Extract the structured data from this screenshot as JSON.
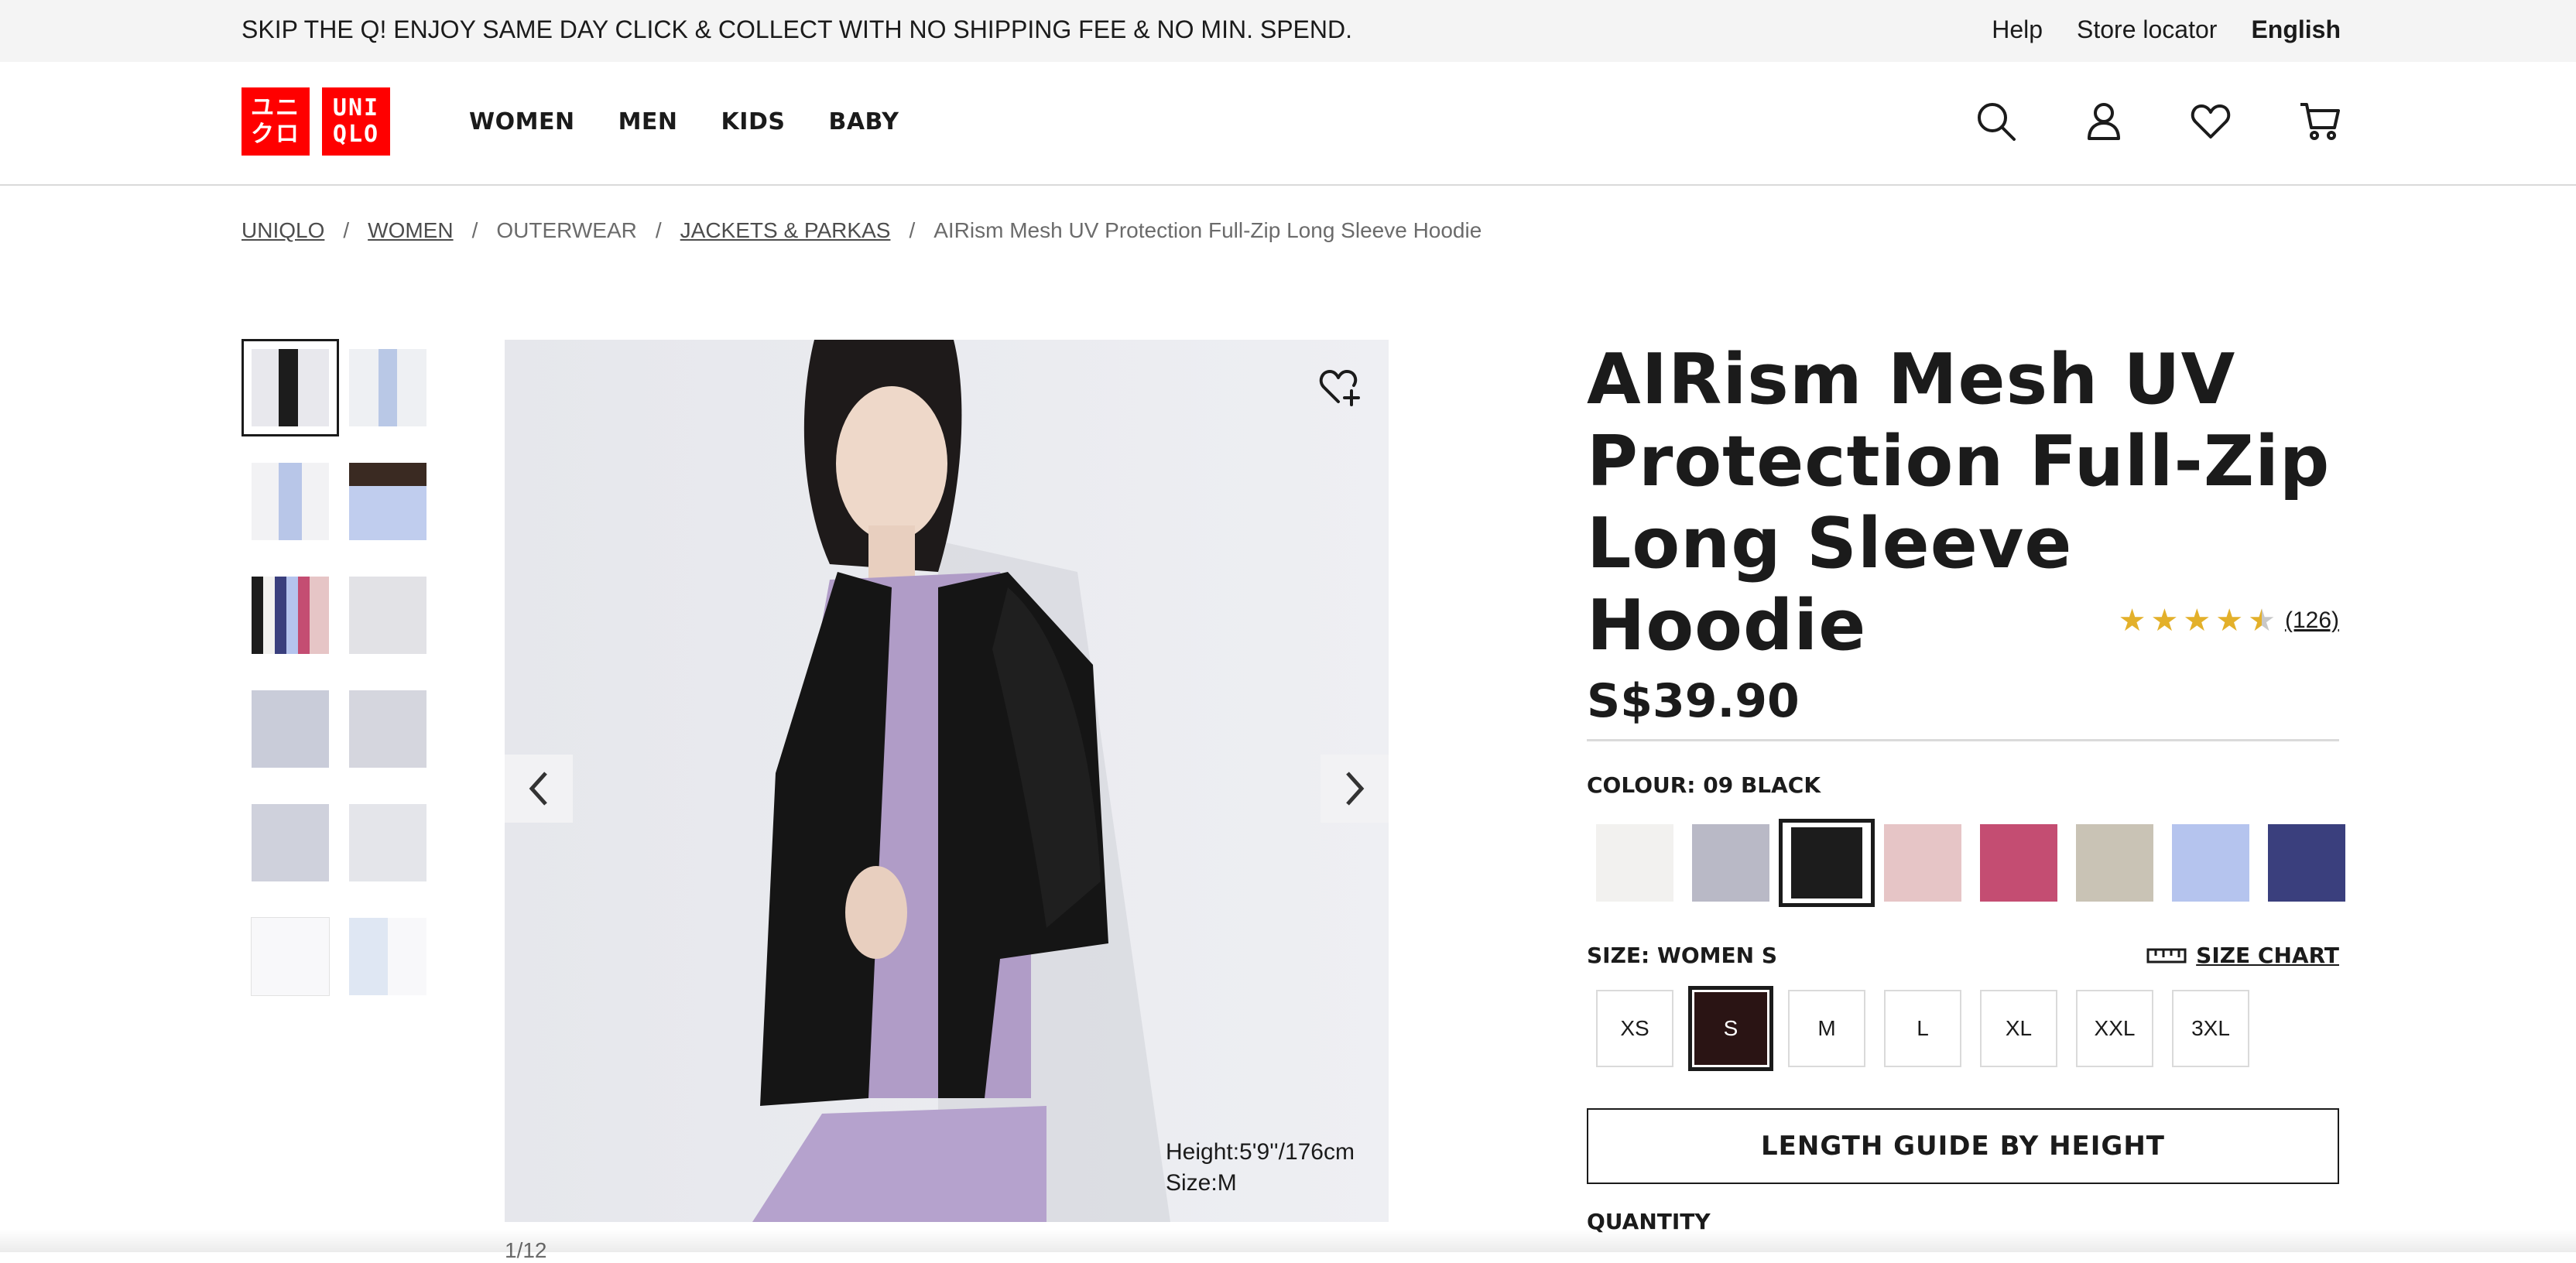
{
  "topbar": {
    "promo": "SKIP THE Q! ENJOY SAME DAY CLICK & COLLECT WITH NO SHIPPING FEE & NO MIN. SPEND.",
    "help": "Help",
    "store_locator": "Store locator",
    "language": "English"
  },
  "logo": {
    "line1": "ユニ",
    "line2": "クロ",
    "line3": "UNI",
    "line4": "QLO"
  },
  "nav": [
    "WOMEN",
    "MEN",
    "KIDS",
    "BABY"
  ],
  "header_icons": [
    "search-icon",
    "account-icon",
    "wishlist-icon",
    "cart-icon"
  ],
  "breadcrumb": [
    {
      "label": "UNIQLO",
      "link": true
    },
    {
      "label": "WOMEN",
      "link": true
    },
    {
      "label": "OUTERWEAR",
      "link": false
    },
    {
      "label": "JACKETS & PARKAS",
      "link": true
    },
    {
      "label": "AIRism Mesh UV Protection Full-Zip Long Sleeve Hoodie",
      "link": false
    }
  ],
  "gallery": {
    "thumb_count": 12,
    "caption_height": "Height:5'9''/176cm",
    "caption_size": "Size:M",
    "counter": "1/12"
  },
  "product": {
    "title_line1": "AIRism Mesh UV",
    "title_line2": "Protection Full-Zip",
    "title_line3": "Long Sleeve Hoodie",
    "price": "S$39.90",
    "rating": 4.5,
    "review_count": "(126)",
    "colour_label": "COLOUR: 09 BLACK",
    "colours": [
      "#f2f1ef",
      "#b9b9c6",
      "#1c1c1c",
      "#e6c5c6",
      "#c44d72",
      "#c9c3b5",
      "#b5c4ee",
      "#3a3f7d"
    ],
    "selected_colour": 2,
    "size_label": "SIZE: WOMEN S",
    "size_chart": "SIZE CHART",
    "sizes": [
      "XS",
      "S",
      "M",
      "L",
      "XL",
      "XXL",
      "3XL"
    ],
    "selected_size": 1,
    "length_guide": "LENGTH GUIDE BY HEIGHT",
    "quantity_label": "QUANTITY"
  }
}
